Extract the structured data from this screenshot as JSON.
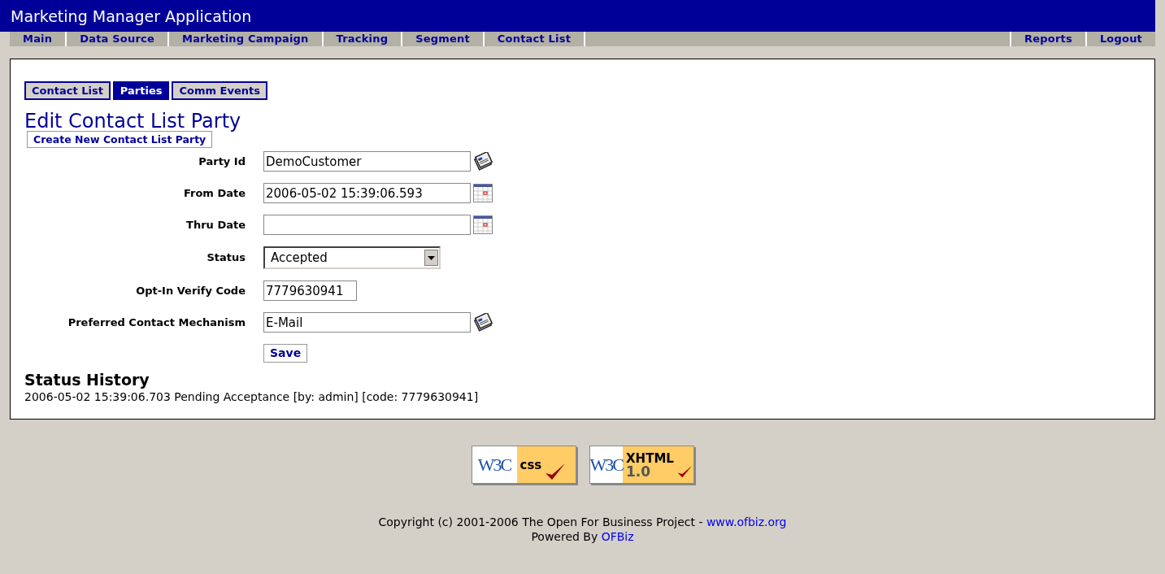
{
  "app_title": "Marketing Manager Application",
  "nav_left": [
    {
      "label": "Main",
      "selected": false
    },
    {
      "label": "Data Source",
      "selected": false
    },
    {
      "label": "Marketing Campaign",
      "selected": false
    },
    {
      "label": "Tracking",
      "selected": false
    },
    {
      "label": "Segment",
      "selected": false
    },
    {
      "label": "Contact List",
      "selected": false
    }
  ],
  "nav_right": [
    {
      "label": "Reports"
    },
    {
      "label": "Logout"
    }
  ],
  "tabs": [
    {
      "label": "Contact List",
      "selected": false
    },
    {
      "label": "Parties",
      "selected": true
    },
    {
      "label": "Comm Events",
      "selected": false
    }
  ],
  "heading": "Edit Contact List Party",
  "create_button": "Create New Contact List Party",
  "fields": [
    {
      "label": "Party Id",
      "kind": "lookup",
      "value": "DemoCustomer"
    },
    {
      "label": "From Date",
      "kind": "date",
      "value": "2006-05-02 15:39:06.593"
    },
    {
      "label": "Thru Date",
      "kind": "date"
    },
    {
      "label": "Status",
      "kind": "select",
      "value": "Accepted"
    },
    {
      "label": "Opt-In Verify Code",
      "kind": "short",
      "value": "7779630941"
    },
    {
      "label": "Preferred Contact Mechanism",
      "kind": "lookup",
      "value": "E-Mail"
    }
  ],
  "save_button": "Save",
  "history_title": "Status History",
  "history": [
    "2006-05-02 15:39:06.703 Pending Acceptance [by: admin] [code: 7779630941]"
  ],
  "badges": [
    {
      "logo": "W3C",
      "label": "css"
    },
    {
      "logo": "W3C",
      "label": "XHTML",
      "version": "1.0"
    }
  ],
  "copyright": "Copyright (c) 2001-2006 The Open For Business Project - ",
  "copyright_link": "www.ofbiz.org",
  "powered_by": "Powered By ",
  "powered_link": "OFBiz"
}
